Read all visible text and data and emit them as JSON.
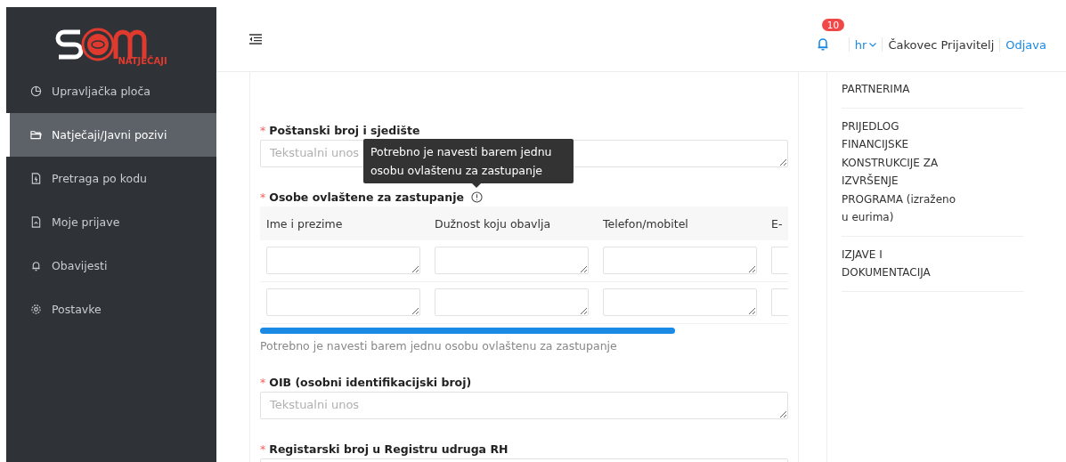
{
  "logo": {
    "text": "NATJEČAJI"
  },
  "sidebar": {
    "items": [
      {
        "label": "Upravljačka ploča",
        "selected": false
      },
      {
        "label": "Natječaji/Javni pozivi",
        "selected": true
      },
      {
        "label": "Pretraga po kodu",
        "selected": false
      },
      {
        "label": "Moje prijave",
        "selected": false
      },
      {
        "label": "Obavijesti",
        "selected": false
      },
      {
        "label": "Postavke",
        "selected": false
      }
    ]
  },
  "header": {
    "notifications": "10",
    "language": "hr",
    "user": "Čakovec Prijavitelj",
    "logout": "Odjava"
  },
  "form": {
    "fields": [
      {
        "kind": "text",
        "label": "Poštanski broj i sjedište",
        "required_mark": "*",
        "placeholder": "Tekstualni unos"
      },
      {
        "kind": "table",
        "label": "Osobe ovlaštene za zastupanje",
        "required_mark": "*",
        "columns": [
          "Ime i prezime",
          "Dužnost koju obavlja",
          "Telefon/mobitel",
          "E-"
        ],
        "hint": "Potrebno je navesti barem jednu osobu ovlaštenu za zastupanje",
        "tooltip": "Potrebno je navesti barem jednu osobu ovlaštenu za zastupanje"
      },
      {
        "kind": "text",
        "label": "OIB (osobni identifikacijski broj)",
        "required_mark": "*",
        "placeholder": "Tekstualni unos"
      },
      {
        "kind": "text",
        "label": "Registarski broj u Registru udruga RH",
        "required_mark": "*"
      }
    ]
  },
  "section_nav": {
    "items": [
      "PARTNERIMA",
      "PRIJEDLOG FINANCIJSKE KONSTRUKCIJE ZA IZVRŠENJE PROGRAMA (izraženo u eurima)",
      "IZJAVE I DOKUMENTACIJA"
    ]
  }
}
